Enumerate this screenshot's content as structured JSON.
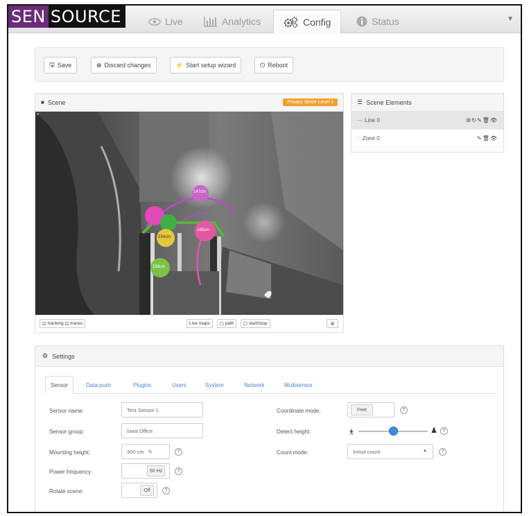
{
  "brand": {
    "part1": "SEN",
    "part2": "S",
    "part3": "OURCE"
  },
  "nav": {
    "tabs": [
      {
        "label": "Live",
        "icon": "eye-icon"
      },
      {
        "label": "Analytics",
        "icon": "bar-chart-icon"
      },
      {
        "label": "Config",
        "icon": "gears-icon"
      },
      {
        "label": "Status",
        "icon": "info-circle-icon"
      }
    ],
    "active": "Config"
  },
  "toolbar": {
    "save": "Save",
    "discard": "Discard changes",
    "wizard": "Start setup wizard",
    "reboot": "Reboot"
  },
  "scene": {
    "title": "Scene",
    "privacy_badge": "Privacy Mode Level 1",
    "zone_labels": [
      "147cm",
      "154cm",
      "165cm",
      "159cm"
    ],
    "footer": {
      "tracking": "tracking",
      "traces": "traces",
      "live_maps": "Live maps",
      "path": "path",
      "start_stop": "start/stop"
    }
  },
  "scene_elements": {
    "title": "Scene Elements",
    "items": [
      {
        "label": "Line 0",
        "tools": "⚙↻✎🗑👁"
      },
      {
        "label": "Zone 0",
        "tools": "✎🗑👁"
      }
    ]
  },
  "settings": {
    "title": "Settings",
    "tabs": [
      "Sensor",
      "Data push",
      "Plugins",
      "Users",
      "System",
      "Network",
      "Multisensor"
    ],
    "active_tab": "Sensor",
    "left_fields": {
      "sensor_name": {
        "label": "Sensor name:",
        "value": "Test Sensor 1"
      },
      "sensor_group": {
        "label": "Sensor group:",
        "value": "Iowa Office"
      },
      "mounting_height": {
        "label": "Mounting height:",
        "value": "300 cm"
      },
      "power_frequency": {
        "label": "Power frequency:",
        "value": "50 Hz"
      },
      "rotate_scene": {
        "label": "Rotate scene:",
        "value": "Off"
      }
    },
    "right_fields": {
      "coordinate_mode": {
        "label": "Coordinate mode:",
        "value": "Feet"
      },
      "detect_height": {
        "label": "Detect height:",
        "level": 0.5
      },
      "count_mode": {
        "label": "Count mode:",
        "value": "In/out count"
      }
    }
  }
}
